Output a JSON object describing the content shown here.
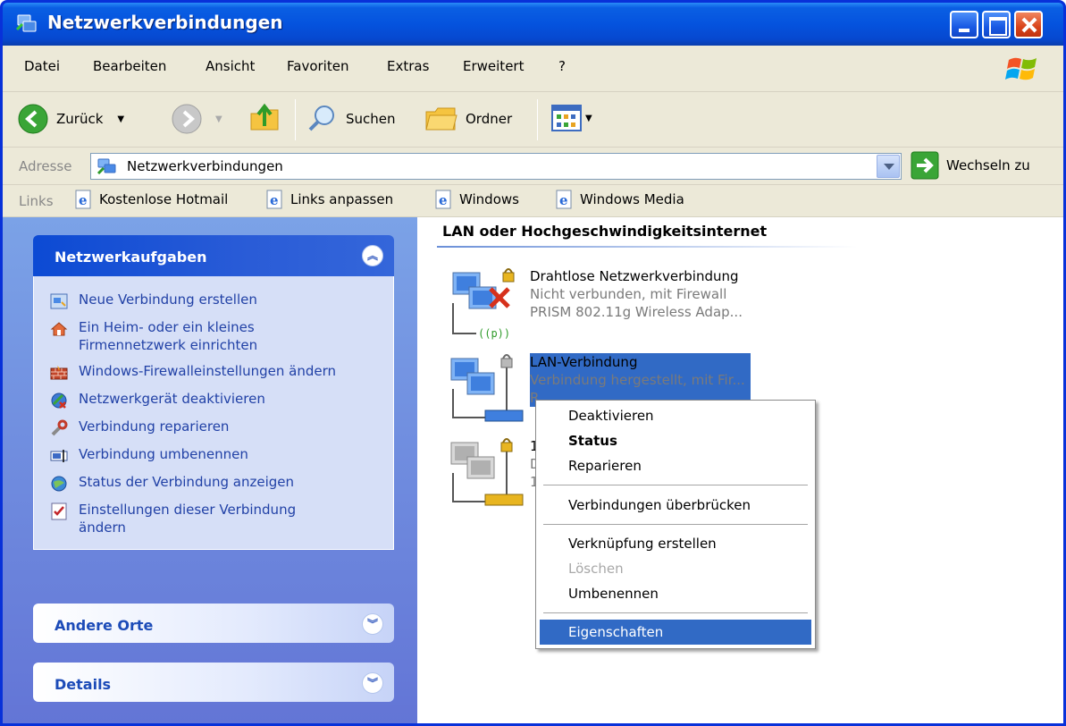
{
  "window": {
    "title": "Netzwerkverbindungen"
  },
  "menu": {
    "items": [
      "Datei",
      "Bearbeiten",
      "Ansicht",
      "Favoriten",
      "Extras",
      "Erweitert",
      "?"
    ]
  },
  "toolbar": {
    "back": "Zurück",
    "search": "Suchen",
    "folders": "Ordner"
  },
  "address": {
    "label": "Adresse",
    "value": "Netzwerkverbindungen",
    "go": "Wechseln zu"
  },
  "links": {
    "label": "Links",
    "items": [
      "Kostenlose Hotmail",
      "Links anpassen",
      "Windows",
      "Windows Media"
    ]
  },
  "tasks": {
    "title": "Netzwerkaufgaben",
    "items": [
      "Neue Verbindung erstellen",
      "Ein Heim- oder ein kleines Firmennetzwerk einrichten",
      "Windows-Firewalleinstellungen ändern",
      "Netzwerkgerät deaktivieren",
      "Verbindung reparieren",
      "Verbindung umbenennen",
      "Status der Verbindung anzeigen",
      "Einstellungen dieser Verbindung ändern"
    ]
  },
  "other_places": {
    "title": "Andere Orte"
  },
  "details": {
    "title": "Details"
  },
  "content": {
    "group_title": "LAN oder Hochgeschwindigkeitsinternet",
    "connections": [
      {
        "name": "Drahtlose Netzwerkverbindung",
        "status": "Nicht verbunden, mit Firewall",
        "device": "PRISM 802.11g Wireless Adap..."
      },
      {
        "name": "LAN-Verbindung",
        "status": "Verbindung hergestellt, mit Fir...",
        "device": "R"
      },
      {
        "name": "1",
        "status": "D",
        "device": "1"
      }
    ]
  },
  "context_menu": {
    "items": [
      "Deaktivieren",
      "Status",
      "Reparieren",
      "Verbindungen überbrücken",
      "Verknüpfung erstellen",
      "Löschen",
      "Umbenennen",
      "Eigenschaften"
    ]
  },
  "colors": {
    "title_bar": "#0553de",
    "selection": "#316ac5",
    "task_pane_top": "#7ba2e7",
    "task_pane_bottom": "#6375d6",
    "link_text": "#2141a6"
  }
}
